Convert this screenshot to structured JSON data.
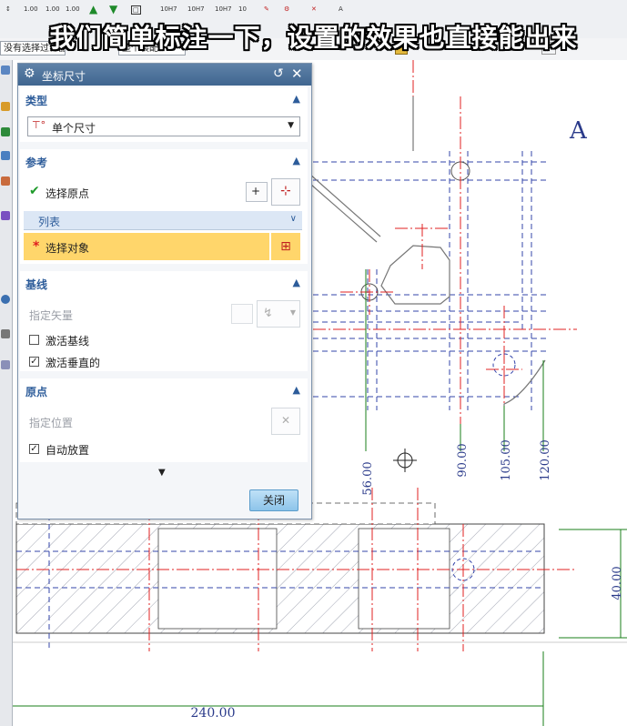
{
  "caption": "我们简单标注一下，设置的效果也直接能出来",
  "toolbar": {
    "labels": [
      "1.00",
      "1.00",
      "1.00",
      "10H7",
      "10H7",
      "10H7",
      "10"
    ],
    "filter_dropdown": "没有选择过滤器",
    "assembly_dropdown": "整个装配"
  },
  "dialog": {
    "title": "坐标尺寸",
    "sections": {
      "type": {
        "heading": "类型",
        "dropdown_value": "单个尺寸"
      },
      "reference": {
        "heading": "参考",
        "select_origin": "选择原点",
        "list_label": "列表",
        "select_object": "选择对象"
      },
      "baseline": {
        "heading": "基线",
        "specify_vector": "指定矢量",
        "activate_baseline": "激活基线",
        "activate_baseline_checked": false,
        "activate_perpendicular": "激活垂直的",
        "activate_perpendicular_checked": true
      },
      "origin": {
        "heading": "原点",
        "specify_position": "指定位置",
        "auto_place": "自动放置",
        "auto_place_checked": true
      }
    },
    "close_label": "关闭"
  },
  "drawing": {
    "view_label": "A",
    "dimensions": [
      "56.00",
      "90.00",
      "105.00",
      "120.00",
      "40.00",
      "240.00"
    ]
  },
  "colors": {
    "accent": "#2d5c9a",
    "title_bar": "#4a6f99",
    "highlight_row": "#ffd66b",
    "dimension": "#1a7f1a",
    "centerline": "#e02020",
    "hidden_line": "#3344aa"
  }
}
